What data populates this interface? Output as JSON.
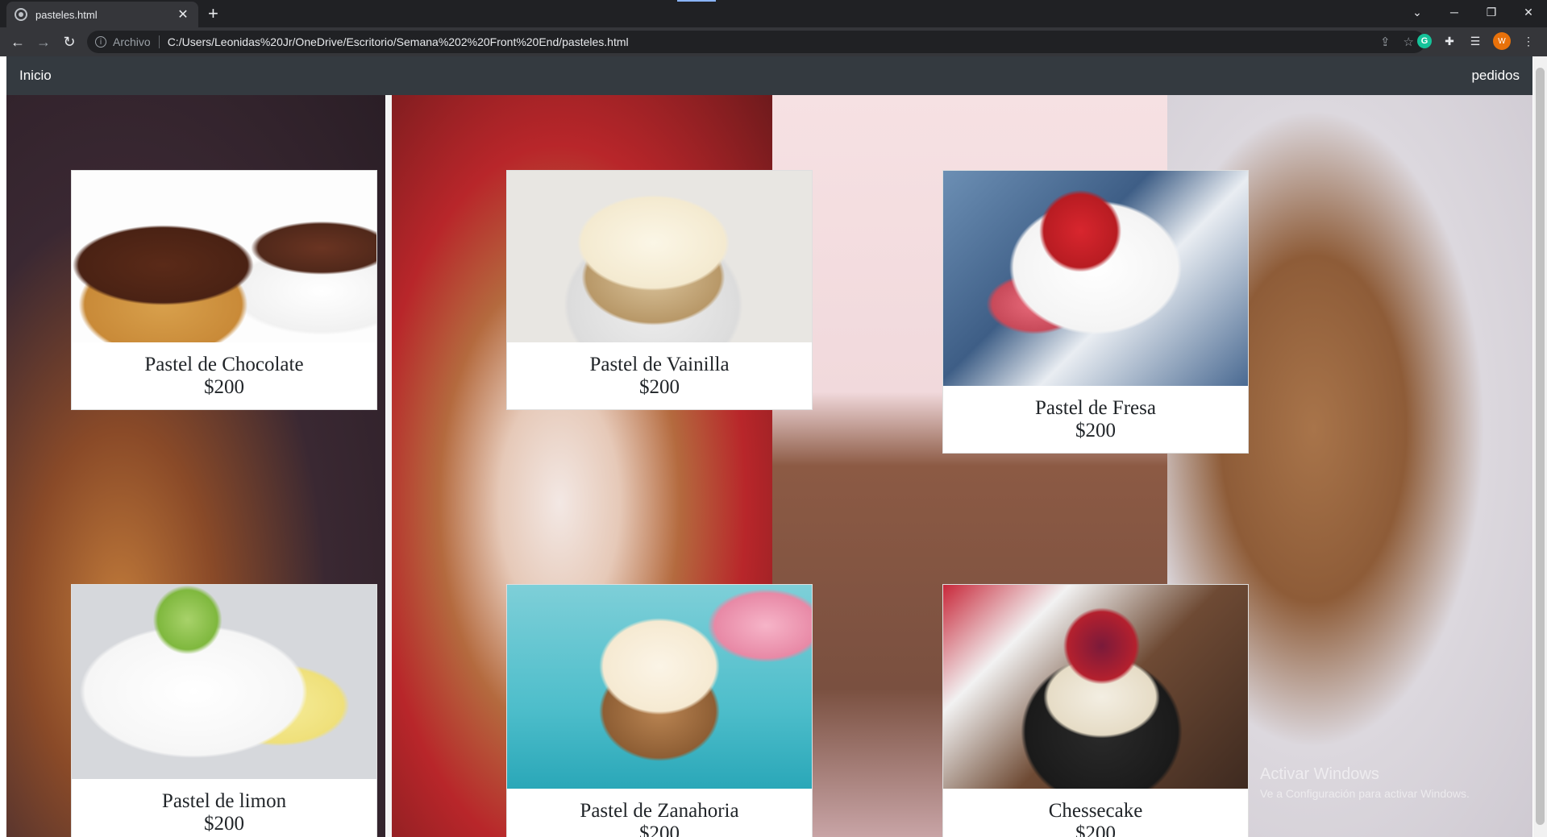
{
  "browser": {
    "tab_title": "pasteles.html",
    "new_tab": "+",
    "scheme_label": "Archivo",
    "url": "C:/Users/Leonidas%20Jr/OneDrive/Escritorio/Semana%202%20Front%20End/pasteles.html",
    "profile_initial": "W",
    "grammarly_label": "G"
  },
  "navbar": {
    "home_label": "Inicio",
    "orders_label": "pedidos"
  },
  "cards": [
    {
      "title": "Pastel de Chocolate",
      "price": "$200"
    },
    {
      "title": "Pastel de Vainilla",
      "price": "$200"
    },
    {
      "title": "Pastel de Fresa",
      "price": "$200"
    },
    {
      "title": "Pastel de limon",
      "price": "$200"
    },
    {
      "title": "Pastel de Zanahoria",
      "price": "$200"
    },
    {
      "title": "Chessecake",
      "price": "$200"
    }
  ],
  "watermark": {
    "title": "Activar Windows",
    "subtitle": "Ve a Configuración para activar Windows."
  }
}
